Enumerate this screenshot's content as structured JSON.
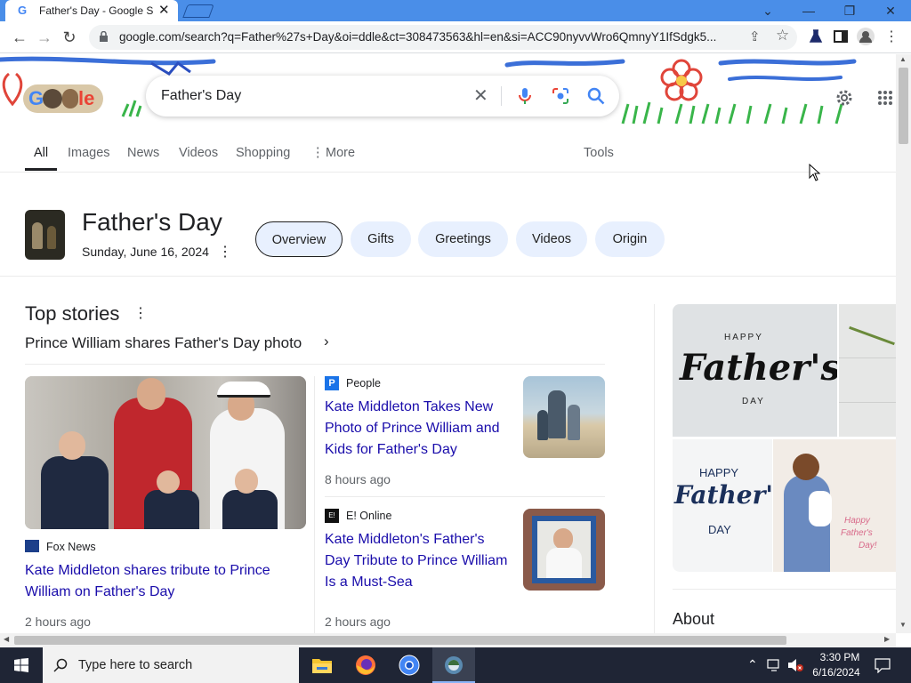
{
  "browser": {
    "tab_title": "Father's Day - Google Search",
    "tab_icon": "G",
    "url": "google.com/search?q=Father%27s+Day&oi=ddle&ct=308473563&hl=en&si=ACC90nyvvWro6QmnyY1IfSdgk5..."
  },
  "search": {
    "query": "Father's Day",
    "nav_tabs": [
      "All",
      "Images",
      "News",
      "Videos",
      "Shopping",
      "More",
      "Tools"
    ]
  },
  "knowledge": {
    "title": "Father's Day",
    "date": "Sunday, June 16, 2024",
    "chips": [
      "Overview",
      "Gifts",
      "Greetings",
      "Videos",
      "Origin"
    ]
  },
  "top_stories": {
    "heading": "Top stories",
    "subheading": "Prince William shares Father's Day photo",
    "main": {
      "source": "Fox News",
      "title": "Kate Middleton shares tribute to Prince William on Father's Day",
      "time": "2 hours ago"
    },
    "stories": [
      {
        "source": "People",
        "title": "Kate Middleton Takes New Photo of Prince William and Kids for Father's Day",
        "time": "8 hours ago"
      },
      {
        "source": "E! Online",
        "title": "Kate Middleton's Father's Day Tribute to Prince William Is a Must-Sea",
        "time": "2 hours ago"
      }
    ]
  },
  "side_panel": {
    "about": "About",
    "img1_text": [
      "HAPPY",
      "Father's",
      "DAY"
    ],
    "img2_text": [
      "HAPPY",
      "Father's",
      "DAY"
    ],
    "img3_text": [
      "Happy",
      "Father's",
      "Day!"
    ]
  },
  "taskbar": {
    "search_placeholder": "Type here to search",
    "time": "3:30 PM",
    "date": "6/16/2024"
  },
  "colors": {
    "link": "#1a0dab",
    "chip_bg": "#e8f0fe",
    "taskbar": "#1f2535",
    "tabbar": "#4a8ee8"
  }
}
